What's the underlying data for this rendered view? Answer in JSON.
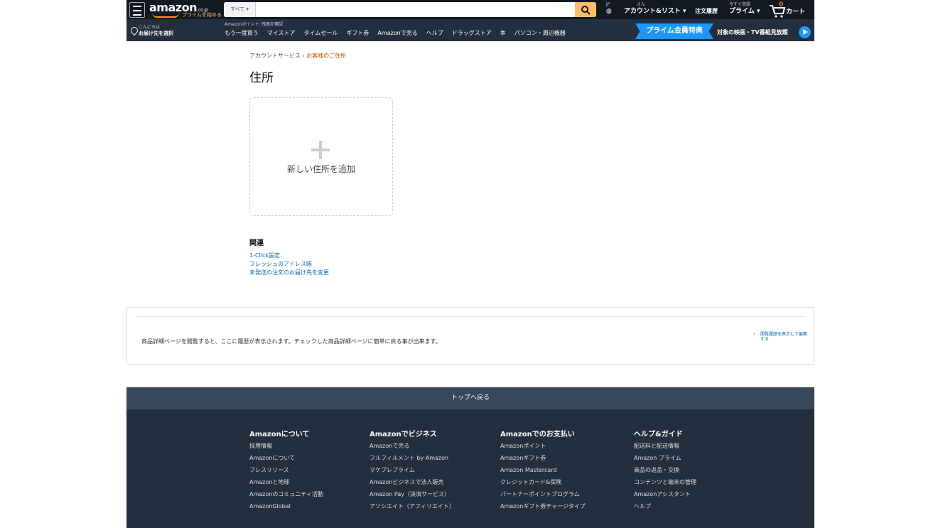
{
  "header": {
    "logo_text": "amazon",
    "logo_tld": ".co.jp",
    "logo_tagline": "プライムを始める",
    "search_category": "すべて ▾",
    "search_placeholder": "",
    "lang": "JP",
    "account_greeting": "さん",
    "account_label": "アカウント&リスト ▾",
    "orders_label": "注文履歴",
    "prime_sub": "今すぐ登録",
    "prime_label": "プライム ▾",
    "cart_count": "0",
    "cart_label": "カート"
  },
  "subnav": {
    "deliver_greeting": "こんにちは",
    "deliver_label": "お届け先を選択",
    "points_text": "Amazonポイント: 残高を確認",
    "items": [
      "もう一度買う",
      "マイストア",
      "タイムセール",
      "ギフト券",
      "Amazonで売る",
      "ヘルプ",
      "ドラッグストア",
      "本",
      "パソコン・周辺機器"
    ],
    "prime_banner": "プライム会員特典",
    "prime_banner_sub": "対象の映画・TV番組見放題"
  },
  "main": {
    "breadcrumb_parent": "アカウントサービス",
    "breadcrumb_sep": "›",
    "breadcrumb_current": "お客様のご住所",
    "title": "住所",
    "add_address_label": "新しい住所を追加",
    "related_title": "関連",
    "related_links": [
      "1-Click設定",
      "フレッシュのアドレス帳",
      "未発送の注文のお届け先を変更"
    ]
  },
  "history": {
    "text": "商品詳細ページを閲覧すると、ここに履歴が表示されます。チェックした商品詳細ページに簡単に戻る事が出来ます。",
    "link": "閲覧履歴を表示して編集する"
  },
  "footer": {
    "back_to_top": "トップへ戻る",
    "columns": [
      {
        "title": "Amazonについて",
        "links": [
          "採用情報",
          "Amazonについて",
          "プレスリリース",
          "Amazonと地球",
          "Amazonのコミュニティ活動",
          "AmazonGlobal"
        ]
      },
      {
        "title": "Amazonでビジネス",
        "links": [
          "Amazonで売る",
          "フルフィルメント by Amazon",
          "マケプレプライム",
          "Amazonビジネスで法人販売",
          "Amazon Pay（決済サービス）",
          "アソシエイト（アフィリエイト）"
        ]
      },
      {
        "title": "Amazonでのお支払い",
        "links": [
          "Amazonポイント",
          "Amazonギフト券",
          "Amazon Mastercard",
          "クレジットカード&保険",
          "パートナーポイントプログラム",
          "Amazonギフト券チャージタイプ"
        ]
      },
      {
        "title": "ヘルプ&ガイド",
        "links": [
          "配送料と配送情報",
          "Amazon プライム",
          "商品の返品・交換",
          "コンテンツと端末の管理",
          "Amazonアシスタント",
          "ヘルプ"
        ]
      }
    ]
  }
}
